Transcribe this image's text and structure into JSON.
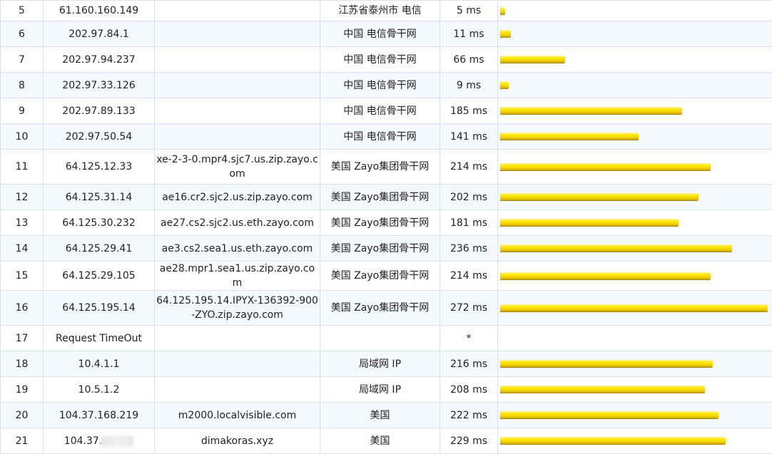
{
  "max_ms": 272,
  "bar_color": "#f5d300",
  "hops": [
    {
      "hop": "5",
      "ip": "61.160.160.149",
      "host": "",
      "location": "江苏省泰州市 电信",
      "latency": "5 ms",
      "ms": 5
    },
    {
      "hop": "6",
      "ip": "202.97.84.1",
      "host": "",
      "location": "中国 电信骨干网",
      "latency": "11 ms",
      "ms": 11
    },
    {
      "hop": "7",
      "ip": "202.97.94.237",
      "host": "",
      "location": "中国 电信骨干网",
      "latency": "66 ms",
      "ms": 66
    },
    {
      "hop": "8",
      "ip": "202.97.33.126",
      "host": "",
      "location": "中国 电信骨干网",
      "latency": "9 ms",
      "ms": 9
    },
    {
      "hop": "9",
      "ip": "202.97.89.133",
      "host": "",
      "location": "中国 电信骨干网",
      "latency": "185 ms",
      "ms": 185
    },
    {
      "hop": "10",
      "ip": "202.97.50.54",
      "host": "",
      "location": "中国 电信骨干网",
      "latency": "141 ms",
      "ms": 141
    },
    {
      "hop": "11",
      "ip": "64.125.12.33",
      "host": "xe-2-3-0.mpr4.sjc7.us.zip.zayo.com",
      "location": "美国 Zayo集团骨干网",
      "latency": "214 ms",
      "ms": 214
    },
    {
      "hop": "12",
      "ip": "64.125.31.14",
      "host": "ae16.cr2.sjc2.us.zip.zayo.com",
      "location": "美国 Zayo集团骨干网",
      "latency": "202 ms",
      "ms": 202
    },
    {
      "hop": "13",
      "ip": "64.125.30.232",
      "host": "ae27.cs2.sjc2.us.eth.zayo.com",
      "location": "美国 Zayo集团骨干网",
      "latency": "181 ms",
      "ms": 181
    },
    {
      "hop": "14",
      "ip": "64.125.29.41",
      "host": "ae3.cs2.sea1.us.eth.zayo.com",
      "location": "美国 Zayo集团骨干网",
      "latency": "236 ms",
      "ms": 236
    },
    {
      "hop": "15",
      "ip": "64.125.29.105",
      "host": "ae28.mpr1.sea1.us.zip.zayo.com",
      "location": "美国 Zayo集团骨干网",
      "latency": "214 ms",
      "ms": 214
    },
    {
      "hop": "16",
      "ip": "64.125.195.14",
      "host": "64.125.195.14.IPYX-136392-900-ZYO.zip.zayo.com",
      "location": "美国 Zayo集团骨干网",
      "latency": "272 ms",
      "ms": 272
    },
    {
      "hop": "17",
      "ip": "Request TimeOut",
      "host": "",
      "location": "",
      "latency": "*",
      "ms": 0
    },
    {
      "hop": "18",
      "ip": "10.4.1.1",
      "host": "",
      "location": "局域网 IP",
      "latency": "216 ms",
      "ms": 216
    },
    {
      "hop": "19",
      "ip": "10.5.1.2",
      "host": "",
      "location": "局域网 IP",
      "latency": "208 ms",
      "ms": 208
    },
    {
      "hop": "20",
      "ip": "104.37.168.219",
      "host": "m2000.localvisible.com",
      "location": "美国",
      "latency": "222 ms",
      "ms": 222
    },
    {
      "hop": "21",
      "ip": "104.37.",
      "host": "dimakoras.xyz",
      "location": "美国",
      "latency": "229 ms",
      "ms": 229
    }
  ]
}
